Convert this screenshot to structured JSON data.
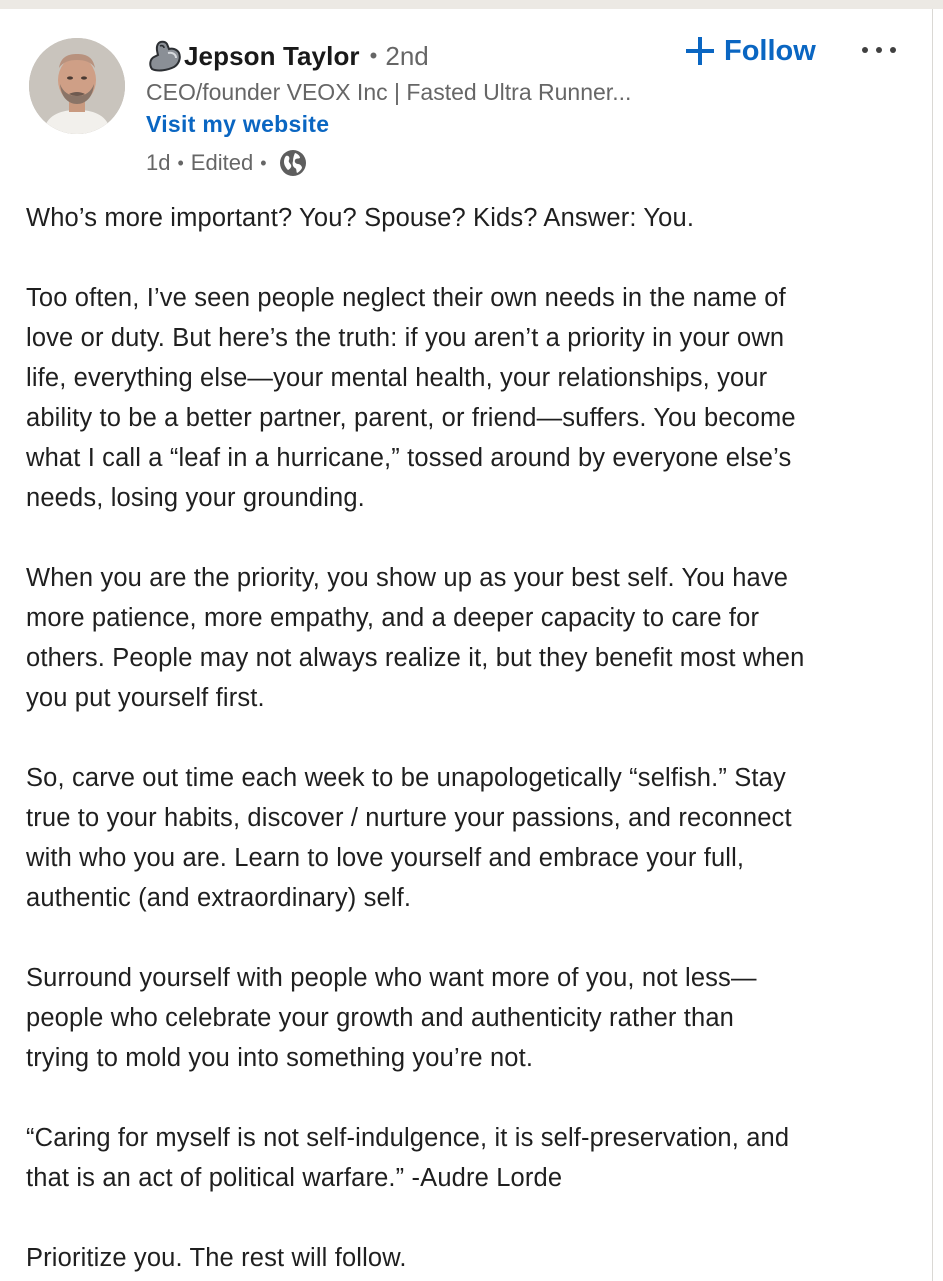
{
  "author": {
    "name": "Jepson Taylor",
    "emoji_icon": "flexed-biceps-icon",
    "degree": "2nd",
    "separator": "•",
    "headline": "CEO/founder VEOX Inc | Fasted Ultra Runner...",
    "website_link": "Visit my website"
  },
  "meta": {
    "age": "1d",
    "edited": "Edited",
    "separator": "•",
    "visibility_icon": "globe-icon"
  },
  "actions": {
    "follow_label": "Follow",
    "follow_icon": "plus-icon",
    "more_icon": "more-options-icon"
  },
  "post": {
    "paragraphs": [
      [
        "Who’s more important? You? Spouse? Kids? Answer: You."
      ],
      [
        "Too often, I’ve seen people neglect their own needs in the name of",
        "love or duty. But here’s the truth: if you aren’t a priority in your own",
        "life, everything else—your mental health, your relationships, your",
        "ability to be a better partner, parent, or friend—suffers. You become",
        "what I call a “leaf in a hurricane,” tossed around by everyone else’s",
        "needs, losing your grounding."
      ],
      [
        "When you are the priority, you show up as your best self. You have",
        "more patience, more empathy, and a deeper capacity to care for",
        "others. People may not always realize it, but they benefit most when",
        "you put yourself first."
      ],
      [
        "So, carve out time each week to be unapologetically “selfish.” Stay",
        "true to your habits, discover / nurture your passions, and reconnect",
        "with who you are. Learn to love yourself and embrace your full,",
        "authentic (and extraordinary) self."
      ],
      [
        "Surround yourself with people who want more of you, not less—",
        "people who celebrate your growth and authenticity rather than",
        "trying to mold you into something you’re not."
      ],
      [
        "“Caring for myself is not self-indulgence, it is self-preservation, and",
        "that is an act of political warfare.” -Audre Lorde"
      ],
      [
        "Prioritize you. The rest will follow."
      ]
    ]
  },
  "colors": {
    "link_blue": "#0a66c2",
    "text_primary": "#1f1f1f",
    "text_secondary": "#666666"
  }
}
